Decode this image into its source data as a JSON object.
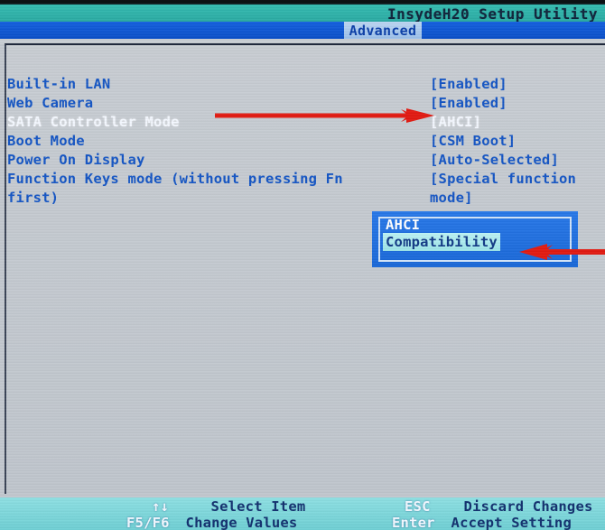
{
  "header": {
    "title": "InsydeH20 Setup Utility",
    "active_tab": "Advanced",
    "title_color": "#10243c",
    "bar_color": "#2fb3ab",
    "tab_bar_color": "#0a55d4"
  },
  "settings": {
    "rows": [
      {
        "label": "Built-in LAN",
        "value": "[Enabled]",
        "selected": false
      },
      {
        "label": "Web Camera",
        "value": "[Enabled]",
        "selected": false
      },
      {
        "label": "SATA Controller Mode",
        "value": "[AHCI]",
        "selected": true
      },
      {
        "label": "Boot Mode",
        "value": "[CSM Boot]",
        "selected": false
      },
      {
        "label": "Power On Display",
        "value": "[Auto-Selected]",
        "selected": false
      },
      {
        "label": "Function Keys mode (without pressing Fn\nfirst)",
        "value": "[Special function\nmode]",
        "selected": false
      }
    ]
  },
  "dropdown": {
    "options": [
      {
        "label": "AHCI",
        "highlighted": false
      },
      {
        "label": "Compatibility",
        "highlighted": true
      }
    ],
    "highlight_bg": "#a8ecef",
    "box_bg": "#1f6fe0"
  },
  "annotations": {
    "arrow_color": "#e21b12",
    "arrows": [
      {
        "name": "arrow-to-sata-value",
        "direction": "right"
      },
      {
        "name": "arrow-to-compatibility-option",
        "direction": "left"
      }
    ]
  },
  "help_bar": {
    "entries": [
      {
        "key": "↑↓",
        "desc": "Select Item"
      },
      {
        "key": "F5/F6",
        "desc": "Change Values"
      },
      {
        "key": "ESC",
        "desc": "Discard Changes"
      },
      {
        "key": "Enter",
        "desc": "Accept Setting"
      }
    ],
    "bg_color": "#7fd8dc",
    "text_color": "#12306e"
  }
}
